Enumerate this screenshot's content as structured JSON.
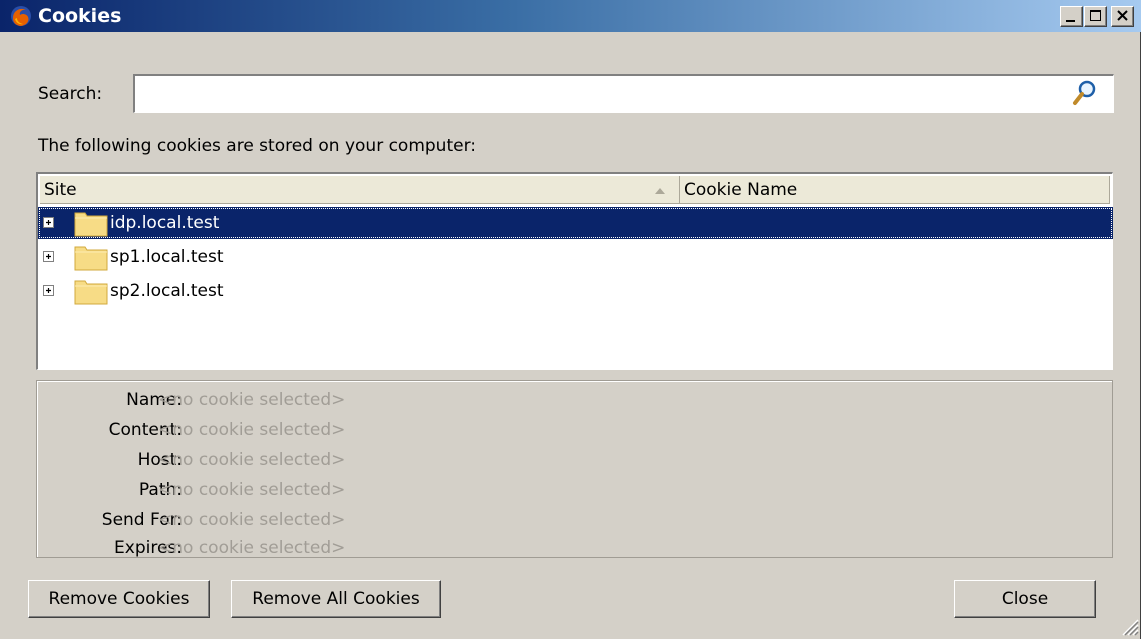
{
  "window": {
    "title": "Cookies"
  },
  "search": {
    "label": "Search:",
    "value": "",
    "placeholder": ""
  },
  "intro": {
    "text": "The following cookies are stored on your computer:"
  },
  "tree": {
    "columns": [
      {
        "label": "Site"
      },
      {
        "label": "Cookie Name"
      }
    ],
    "rows": [
      {
        "label": "idp.local.test",
        "selected": true
      },
      {
        "label": "sp1.local.test",
        "selected": false
      },
      {
        "label": "sp2.local.test",
        "selected": false
      }
    ]
  },
  "details": [
    {
      "label": "Name:",
      "value": "<no cookie selected>"
    },
    {
      "label": "Content:",
      "value": "<no cookie selected>"
    },
    {
      "label": "Host:",
      "value": "<no cookie selected>"
    },
    {
      "label": "Path:",
      "value": "<no cookie selected>"
    },
    {
      "label": "Send For:",
      "value": "<no cookie selected>"
    },
    {
      "label": "Expires:",
      "value": "<no cookie selected>"
    }
  ],
  "buttons": {
    "remove": "Remove Cookies",
    "remove_all": "Remove All Cookies",
    "close": "Close"
  },
  "icons": {
    "app": "firefox-icon",
    "search": "magnifier-icon",
    "folder": "folder-icon",
    "expander": "plus-box-icon"
  },
  "colors": {
    "selection": "#0a246a",
    "titlebar_start": "#0a246a",
    "titlebar_end": "#a6caf0",
    "window_bg": "#d4d0c8",
    "disabled_text": "#a19d96"
  }
}
